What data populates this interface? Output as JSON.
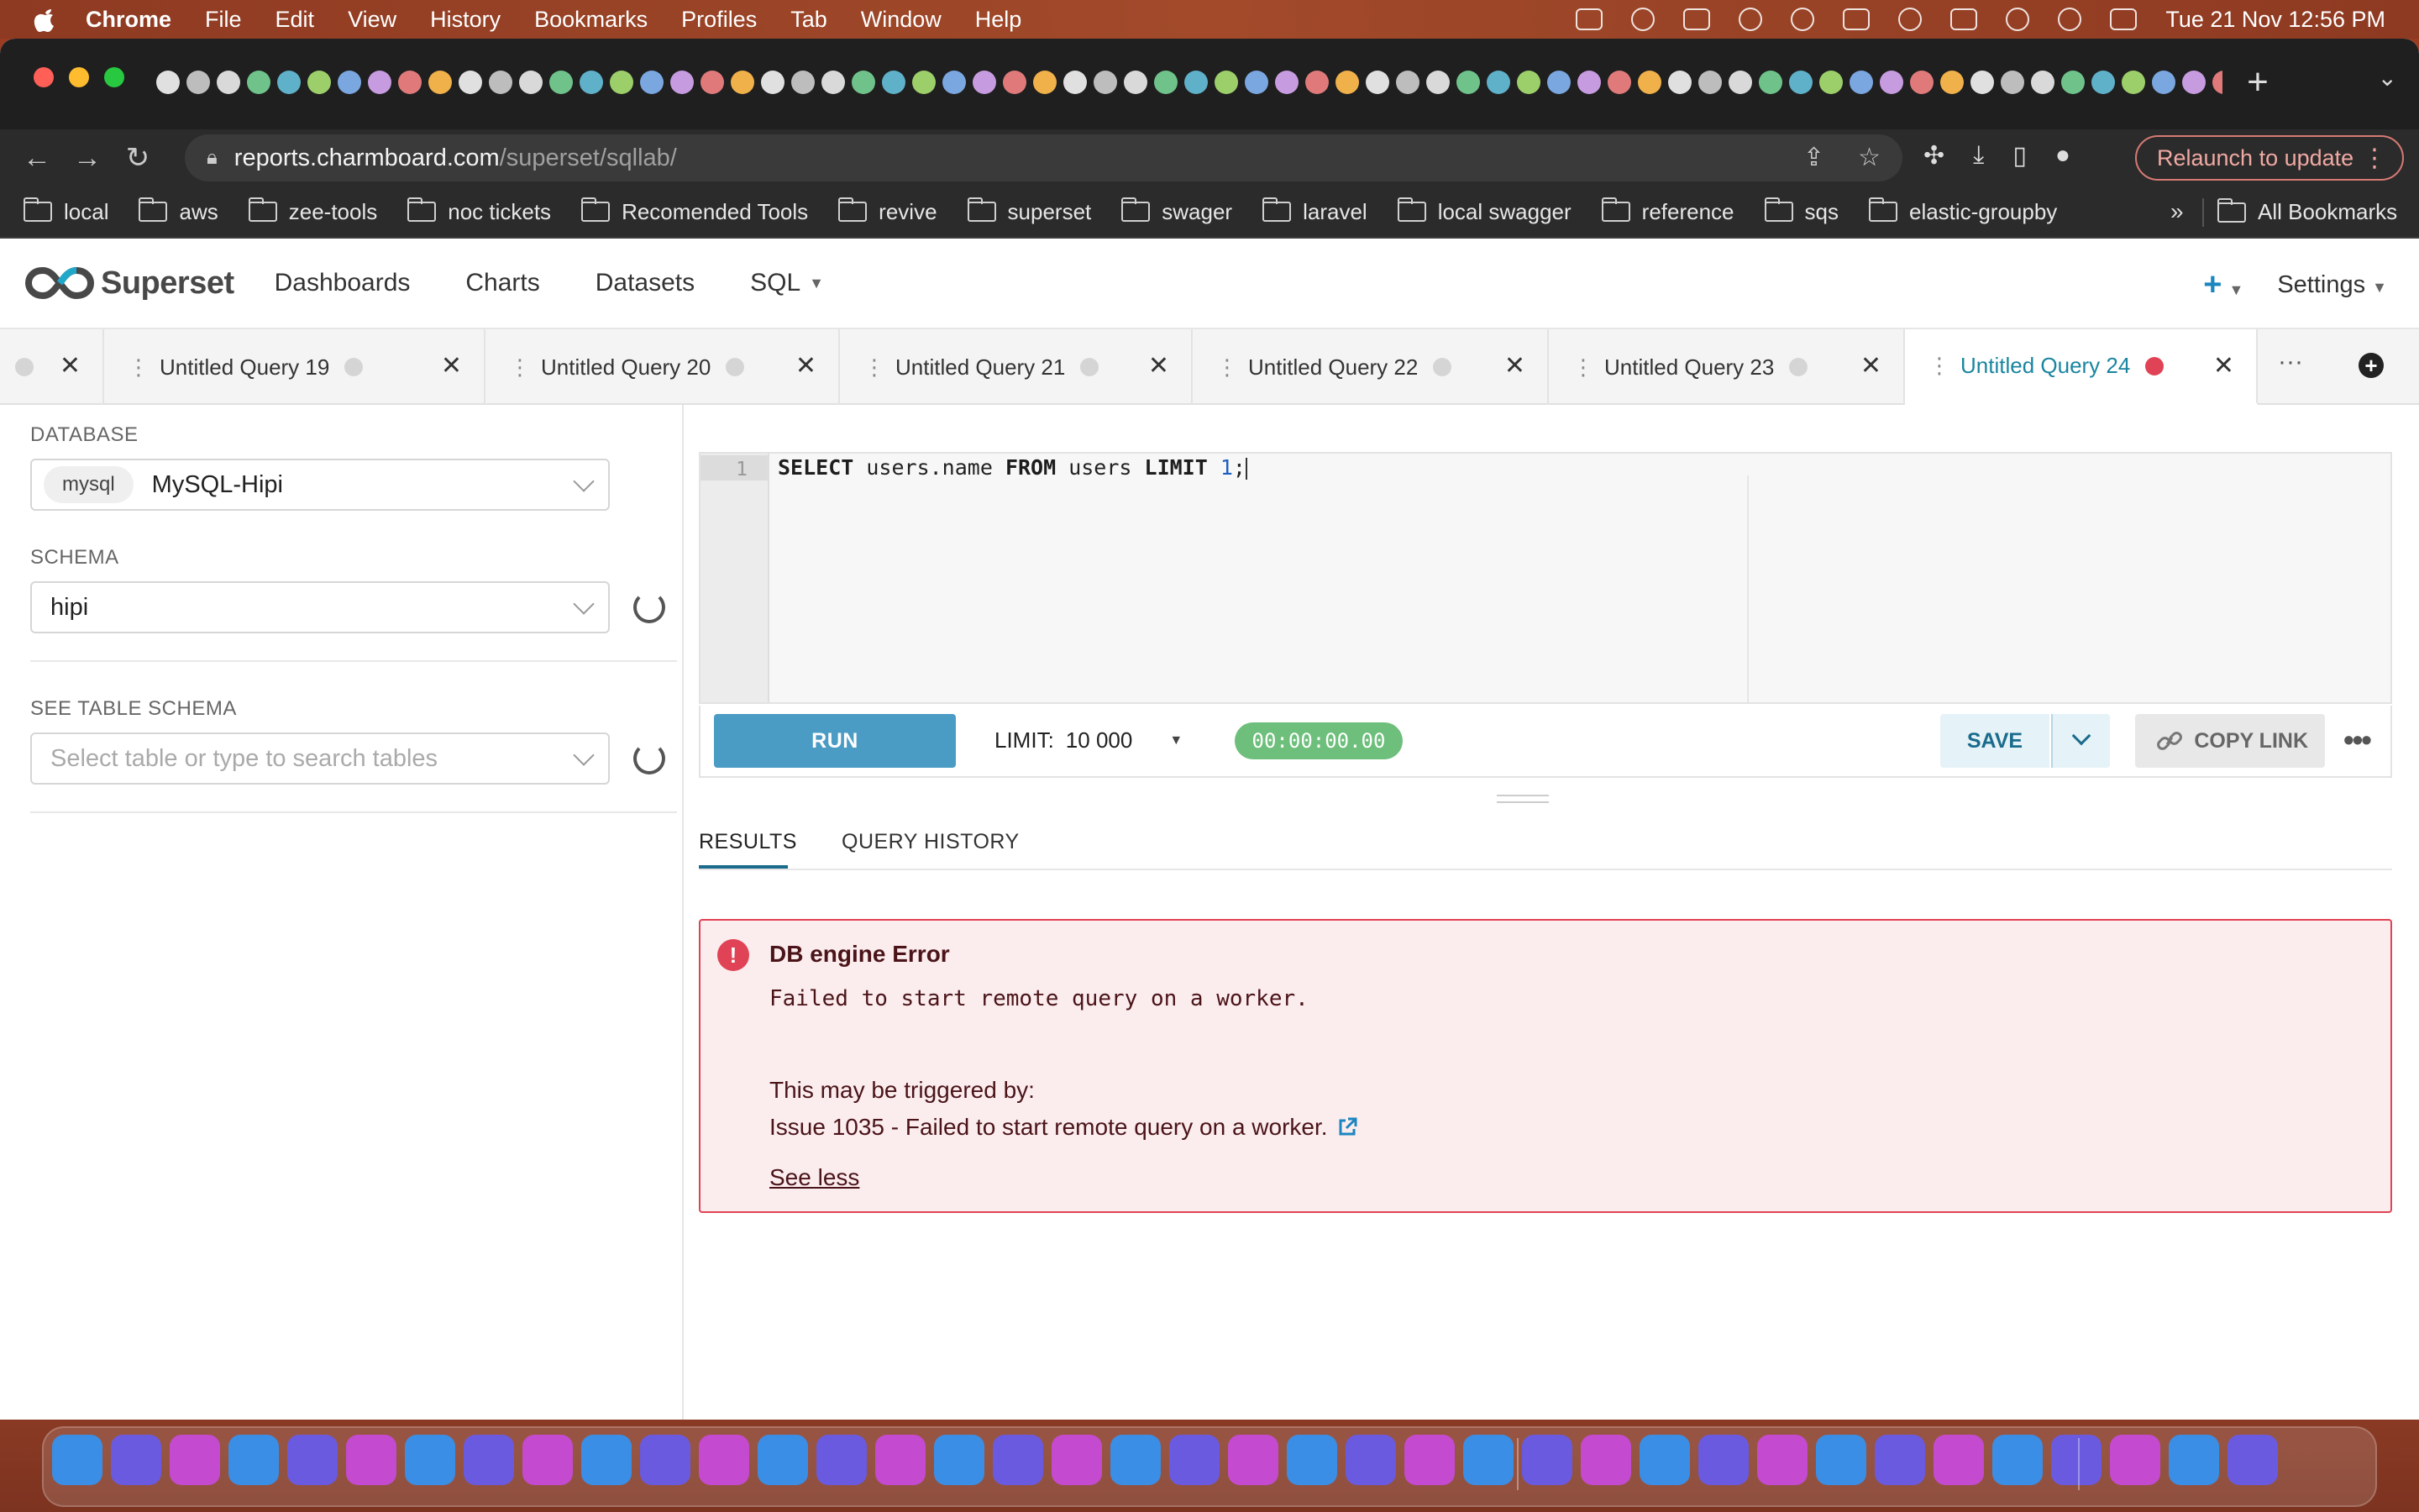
{
  "menubar": {
    "app": "Chrome",
    "items": [
      "File",
      "Edit",
      "View",
      "History",
      "Bookmarks",
      "Profiles",
      "Tab",
      "Window",
      "Help"
    ],
    "clock": "Tue 21 Nov  12:56 PM"
  },
  "browser": {
    "url_host": "reports.charmboard.com",
    "url_path": "/superset/sqllab/",
    "relaunch_label": "Relaunch to update",
    "bookmarks": [
      "local",
      "aws",
      "zee-tools",
      "noc tickets",
      "Recomended Tools",
      "revive",
      "superset",
      "swager",
      "laravel",
      "local swagger",
      "reference",
      "sqs",
      "elastic-groupby"
    ],
    "more_bookmarks": "»",
    "all_bookmarks": "All Bookmarks"
  },
  "app": {
    "logo_text": "Superset",
    "nav": [
      "Dashboards",
      "Charts",
      "Datasets",
      "SQL"
    ],
    "settings_label": "Settings"
  },
  "query_tabs": [
    {
      "label": "Untitled Query 19"
    },
    {
      "label": "Untitled Query 20"
    },
    {
      "label": "Untitled Query 21"
    },
    {
      "label": "Untitled Query 22"
    },
    {
      "label": "Untitled Query 23"
    },
    {
      "label": "Untitled Query 24",
      "active": true
    }
  ],
  "left_panel": {
    "database_label": "DATABASE",
    "database_badge": "mysql",
    "database_value": "MySQL-Hipi",
    "schema_label": "SCHEMA",
    "schema_value": "hipi",
    "table_label": "SEE TABLE SCHEMA",
    "table_placeholder": "Select table or type to search tables"
  },
  "editor": {
    "line_number": "1",
    "sql_kw1": "SELECT",
    "sql_part1": " users.name ",
    "sql_kw2": "FROM",
    "sql_part2": " users ",
    "sql_kw3": "LIMIT",
    "sql_num": " 1",
    "sql_end": ";"
  },
  "run_bar": {
    "run_label": "RUN",
    "limit_label": "LIMIT:",
    "limit_value": "10 000",
    "timer": "00:00:00.00",
    "save_label": "SAVE",
    "copy_link_label": "COPY LINK"
  },
  "results": {
    "tabs": [
      "RESULTS",
      "QUERY HISTORY"
    ],
    "error_title": "DB engine Error",
    "error_message": "Failed to start remote query on a worker.",
    "trigger_label": "This may be triggered by:",
    "issue_text": "Issue 1035 - Failed to start remote query on a worker.",
    "see_less": "See less"
  },
  "colors": {
    "accent": "#1a85a0",
    "run_button": "#4a9cc4",
    "error": "#e04355",
    "timer": "#6dbf7b"
  }
}
